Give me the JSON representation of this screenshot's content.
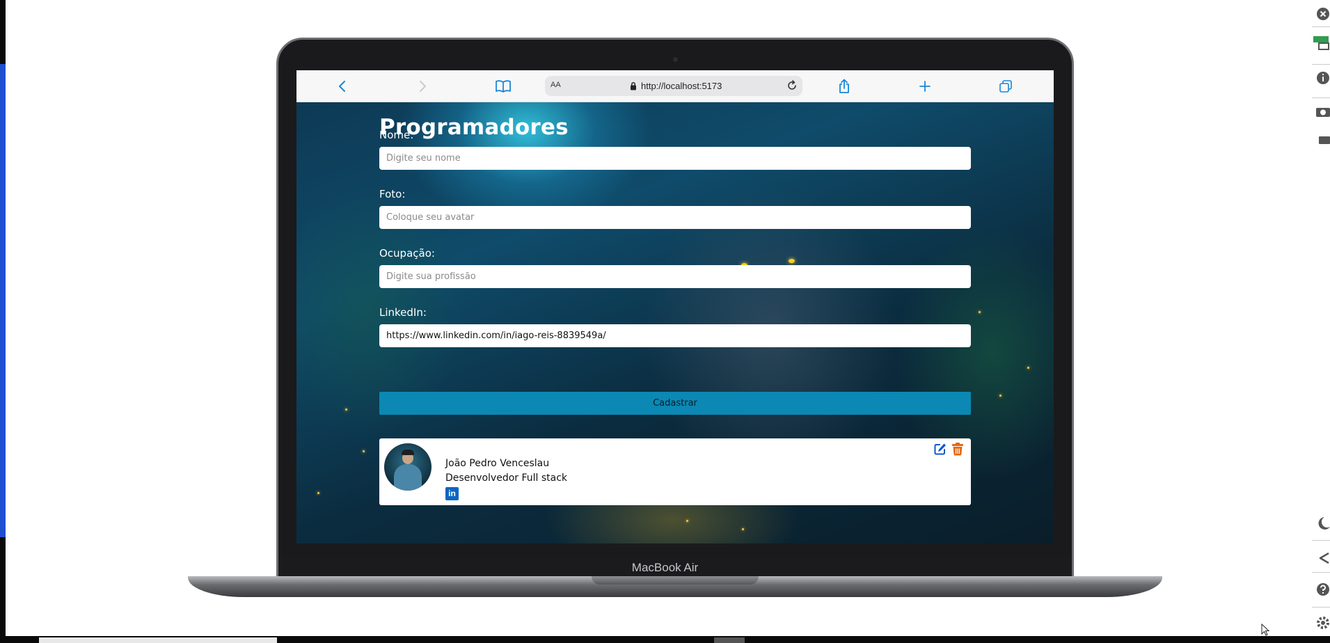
{
  "browser": {
    "text_size_label": "AA",
    "url": "http://localhost:5173"
  },
  "device": {
    "label": "MacBook Air"
  },
  "page": {
    "title": "Programadores",
    "form": {
      "fields": [
        {
          "label": "Nome:",
          "value": "",
          "placeholder": "Digite seu nome"
        },
        {
          "label": "Foto:",
          "value": "",
          "placeholder": "Coloque seu avatar"
        },
        {
          "label": "Ocupação:",
          "value": "",
          "placeholder": "Digite sua profissão"
        },
        {
          "label": "LinkedIn:",
          "value": "https://www.linkedin.com/in/iago-reis-8839549a/",
          "placeholder": ""
        }
      ],
      "submit_label": "Cadastrar"
    },
    "cards": [
      {
        "name": "João Pedro Venceslau",
        "occupation": "Desenvolvedor Full stack",
        "linkedin_icon": "linkedin-icon",
        "edit_icon": "edit-icon",
        "delete_icon": "trash-icon"
      }
    ]
  },
  "colors": {
    "submit_button": "#0b88b3",
    "edit_icon": "#0b57d0",
    "trash_icon": "#e06a12",
    "linkedin": "#0a66c2",
    "browser_accent": "#1a86d6"
  },
  "icons": {
    "browser_toolbar": [
      "back-icon",
      "forward-icon",
      "bookmarks-icon",
      "lock-icon",
      "reload-icon",
      "share-icon",
      "new-tab-icon",
      "tabs-icon"
    ],
    "side_tools": [
      "close-icon",
      "new-badge-icon",
      "info-icon",
      "camera-icon",
      "record-icon",
      "moon-icon",
      "share-icon",
      "help-icon",
      "settings-icon"
    ]
  }
}
